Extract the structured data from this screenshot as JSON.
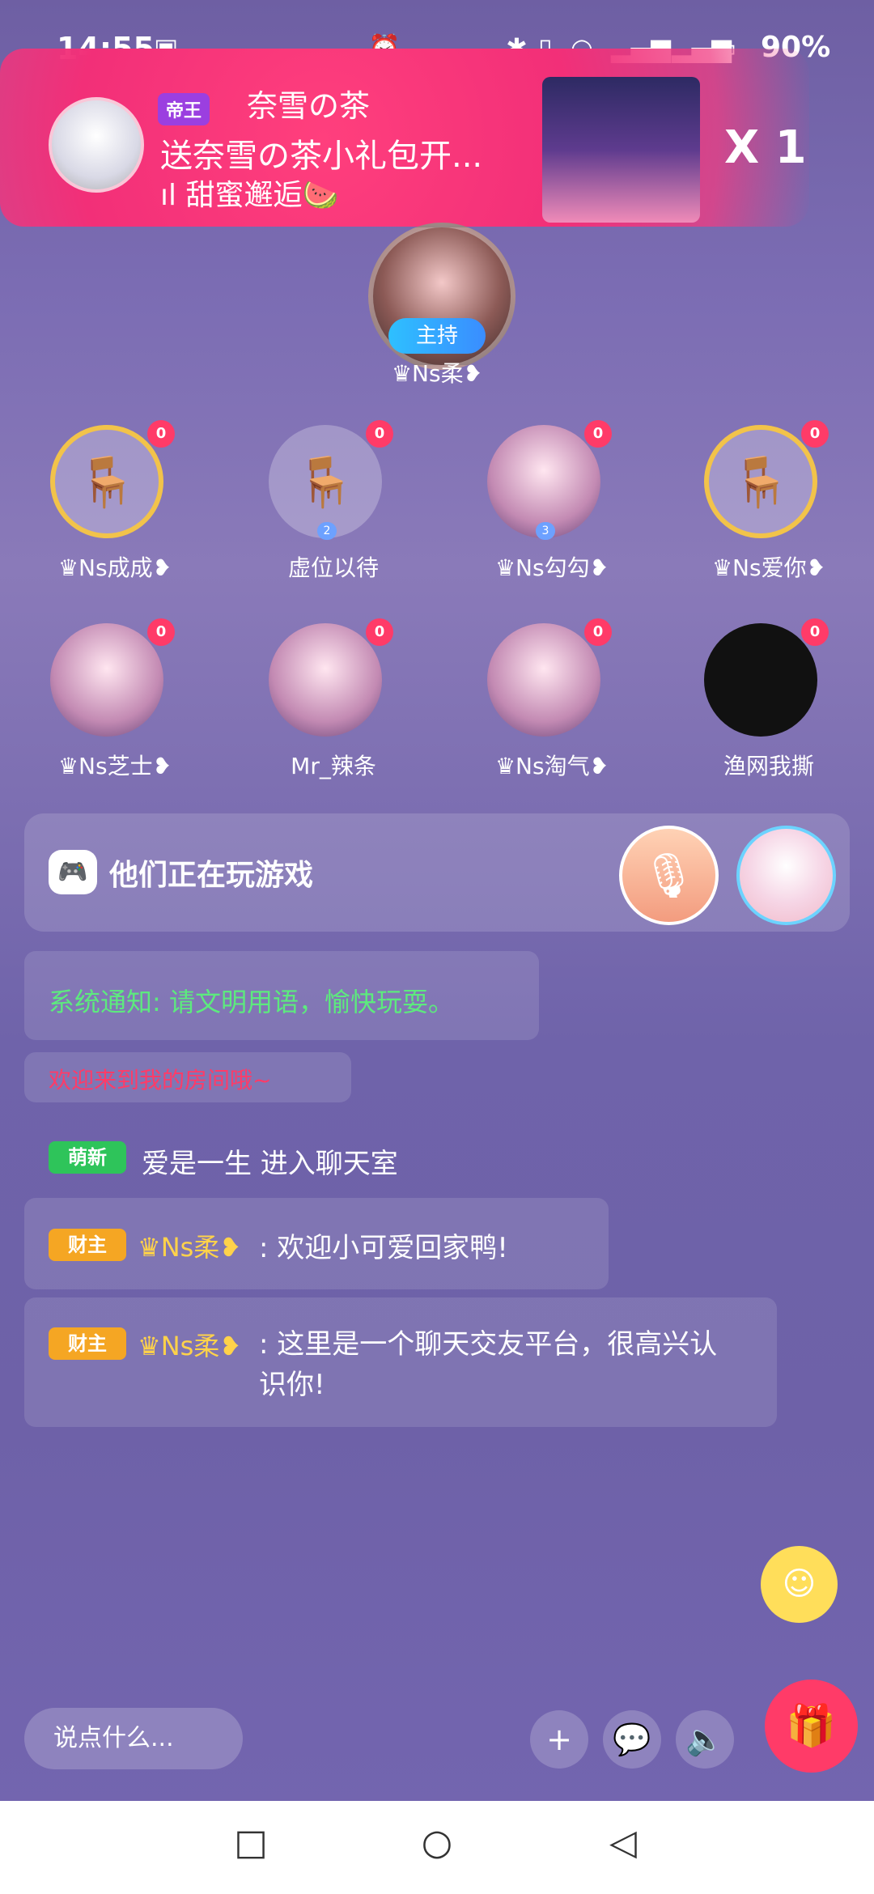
{
  "status_bar": {
    "time": "14:55",
    "battery": "90%"
  },
  "banner": {
    "vip_label": "帝王",
    "user": "奈雪の茶",
    "line": "送奈雪の茶小礼包开...",
    "song": "ıl 甜蜜邂逅🍉",
    "count": "X 1"
  },
  "host": {
    "tag": "主持",
    "name": "♛Ns柔❥"
  },
  "seats": [
    {
      "name": "♛Ns成成❥",
      "badge": "0"
    },
    {
      "name": "虚位以待",
      "badge": "0",
      "num": "2"
    },
    {
      "name": "♛Ns勾勾❥",
      "badge": "0",
      "num": "3"
    },
    {
      "name": "♛Ns爱你❥",
      "badge": "0"
    },
    {
      "name": "♛Ns芝士❥",
      "badge": "0"
    },
    {
      "name": "Mr_辣条",
      "badge": "0"
    },
    {
      "name": "♛Ns淘气❥",
      "badge": "0"
    },
    {
      "name": "渔网我撕",
      "badge": "0"
    }
  ],
  "game_bar": {
    "text": "他们正在玩游戏"
  },
  "chat": {
    "system": "系统通知: 请文明用语，愉快玩耍。",
    "welcome": "欢迎来到我的房间哦~",
    "enter": {
      "badge": "萌新",
      "text": "爱是一生 进入聊天室"
    },
    "messages": [
      {
        "badge": "财主",
        "name": "♛Ns柔❥",
        "text": ": 欢迎小可爱回家鸭!"
      },
      {
        "badge": "财主",
        "name": "♛Ns柔❥",
        "text": ": 这里是一个聊天交友平台，很高兴认识你!"
      }
    ]
  },
  "bottom": {
    "input_placeholder": "说点什么..."
  }
}
